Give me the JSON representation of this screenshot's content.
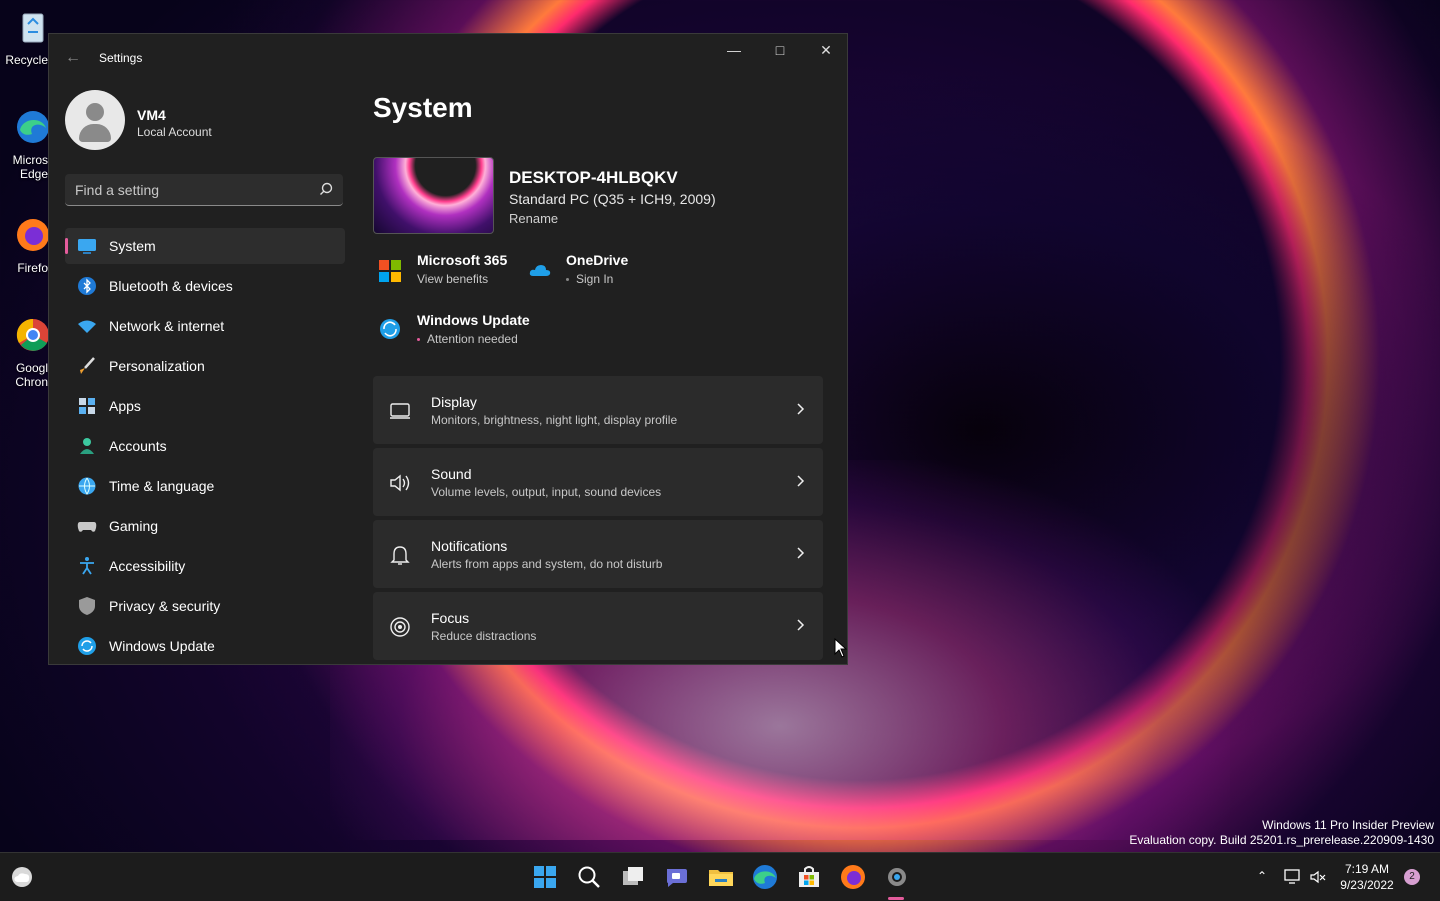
{
  "desktop": {
    "icons": [
      {
        "label": "Recycle",
        "icon": "recycle-bin-icon"
      },
      {
        "label": "Micros\nEdge",
        "icon": "edge-icon"
      },
      {
        "label": "Firefo",
        "icon": "firefox-icon"
      },
      {
        "label": "Googl\nChron",
        "icon": "chrome-icon"
      }
    ],
    "watermark": {
      "line1": "Windows 11 Pro Insider Preview",
      "line2": "Evaluation copy. Build 25201.rs_prerelease.220909-1430"
    }
  },
  "window": {
    "title": "Settings",
    "back_icon": "back-arrow-icon"
  },
  "profile": {
    "name": "VM4",
    "account_type": "Local Account"
  },
  "search": {
    "placeholder": "Find a setting",
    "value": ""
  },
  "nav": {
    "items": [
      {
        "label": "System",
        "icon": "system-icon",
        "active": true
      },
      {
        "label": "Bluetooth & devices",
        "icon": "bluetooth-icon"
      },
      {
        "label": "Network & internet",
        "icon": "wifi-icon"
      },
      {
        "label": "Personalization",
        "icon": "brush-icon"
      },
      {
        "label": "Apps",
        "icon": "apps-icon"
      },
      {
        "label": "Accounts",
        "icon": "account-icon"
      },
      {
        "label": "Time & language",
        "icon": "globe-clock-icon"
      },
      {
        "label": "Gaming",
        "icon": "gamepad-icon"
      },
      {
        "label": "Accessibility",
        "icon": "accessibility-icon"
      },
      {
        "label": "Privacy & security",
        "icon": "shield-icon"
      },
      {
        "label": "Windows Update",
        "icon": "update-icon"
      }
    ]
  },
  "main": {
    "title": "System",
    "device": {
      "name": "DESKTOP-4HLBQKV",
      "model": "Standard PC (Q35 + ICH9, 2009)",
      "rename": "Rename"
    },
    "tiles": {
      "m365": {
        "title": "Microsoft 365",
        "sub": "View benefits"
      },
      "onedrive": {
        "title": "OneDrive",
        "sub": "Sign In"
      },
      "update": {
        "title": "Windows Update",
        "sub": "Attention needed"
      }
    },
    "cards": [
      {
        "title": "Display",
        "sub": "Monitors, brightness, night light, display profile",
        "icon": "monitor-icon"
      },
      {
        "title": "Sound",
        "sub": "Volume levels, output, input, sound devices",
        "icon": "speaker-icon"
      },
      {
        "title": "Notifications",
        "sub": "Alerts from apps and system, do not disturb",
        "icon": "bell-icon"
      },
      {
        "title": "Focus",
        "sub": "Reduce distractions",
        "icon": "focus-icon"
      }
    ]
  },
  "taskbar": {
    "time": "7:19 AM",
    "date": "9/23/2022",
    "notification_count": "2",
    "apps": [
      "start-icon",
      "search-icon",
      "task-view-icon",
      "chat-icon",
      "file-explorer-icon",
      "edge-icon",
      "store-icon",
      "firefox-icon",
      "settings-icon"
    ]
  },
  "colors": {
    "accent": "#e45c9c",
    "window_bg": "#202020",
    "card_bg": "#2b2b2b",
    "update_blue": "#1f9fe8"
  }
}
